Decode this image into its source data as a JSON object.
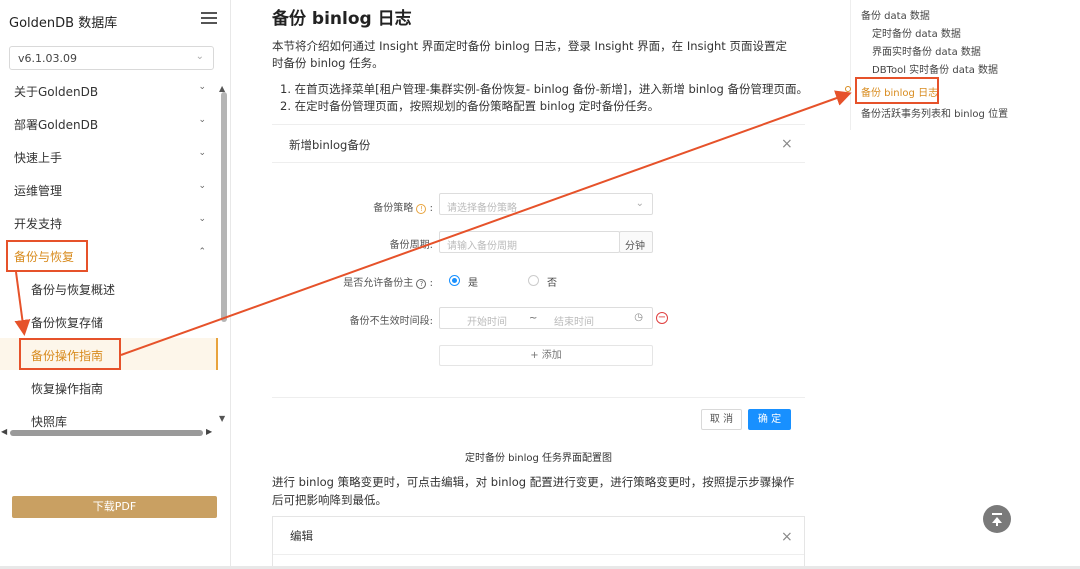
{
  "sidebar": {
    "title": "GoldenDB 数据库",
    "version": "v6.1.03.09",
    "items": [
      {
        "label": "关于GoldenDB",
        "chevron": "⌄"
      },
      {
        "label": "部署GoldenDB",
        "chevron": "⌄"
      },
      {
        "label": "快速上手",
        "chevron": "⌄"
      },
      {
        "label": "运维管理",
        "chevron": "⌄"
      },
      {
        "label": "开发支持",
        "chevron": "⌄"
      },
      {
        "label": "备份与恢复",
        "chevron": "⌃"
      },
      {
        "label": "备份与恢复概述"
      },
      {
        "label": "备份恢复存储"
      },
      {
        "label": "备份操作指南"
      },
      {
        "label": "恢复操作指南"
      },
      {
        "label": "快照库"
      }
    ],
    "pdf_button": "下载PDF"
  },
  "main": {
    "title": "备份 binlog 日志",
    "intro": "本节将介绍如何通过 Insight 界面定时备份 binlog 日志，登录 Insight 界面，在 Insight 页面设置定时备份 binlog 任务。",
    "steps": [
      "1. 在首页选择菜单[租户管理-集群实例-备份恢复- binlog 备份-新增]，进入新增 binlog 备份管理页面。",
      "2. 在定时备份管理页面，按照规划的备份策略配置 binlog 定时备份任务。"
    ],
    "dialog": {
      "title": "新增binlog备份",
      "close": "×",
      "strategy_label": "备份策略",
      "strategy_placeholder": "请选择备份策略",
      "period_label": "备份周期:",
      "period_placeholder": "请输入备份周期",
      "period_unit": "分钟",
      "allow_master_label": "是否允许备份主",
      "yes": "是",
      "no": "否",
      "no_effect_label": "备份不生效时间段:",
      "start_placeholder": "开始时间",
      "tilde": "~",
      "end_placeholder": "结束时间",
      "add": "+ 添加",
      "cancel": "取 消",
      "ok": "确 定"
    },
    "caption": "定时备份 binlog 任务界面配置图",
    "para2": "进行 binlog 策略变更时，可点击编辑，对 binlog 配置进行变更，进行策略变更时，按照提示步骤操作后可把影响降到最低。",
    "edit_dialog": {
      "title": "编辑",
      "close": "×"
    }
  },
  "toc": {
    "items": [
      "备份 data 数据",
      "定时备份 data 数据",
      "界面实时备份 data 数据",
      "DBTool 实时备份 data 数据",
      "备份 binlog 日志",
      "备份活跃事务列表和 binlog 位置"
    ]
  },
  "colors": {
    "accent": "#d88b1e",
    "annotation": "#e6522a",
    "primary": "#1890ff"
  }
}
